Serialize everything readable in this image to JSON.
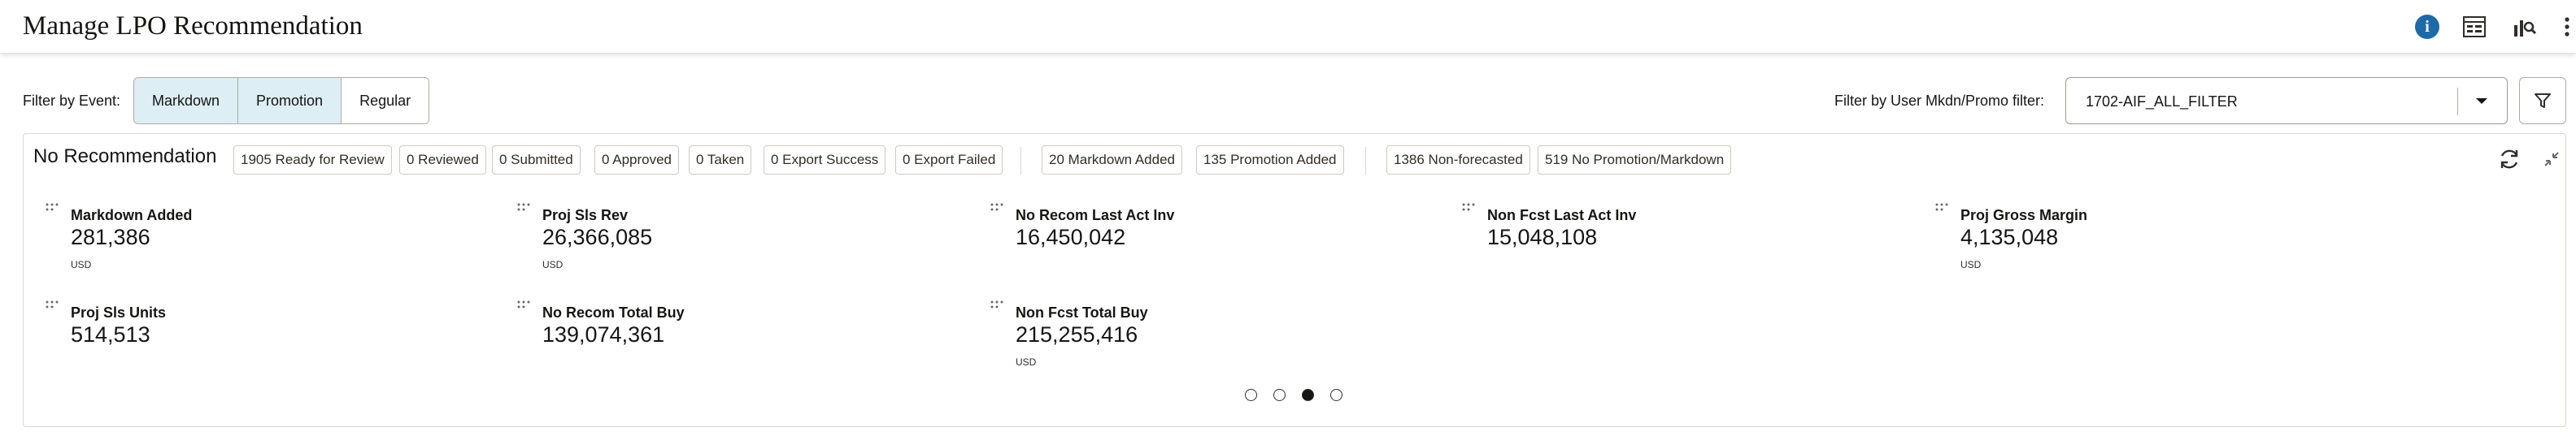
{
  "header": {
    "title": "Manage LPO Recommendation",
    "icons": [
      "info-icon",
      "table-view-icon",
      "chart-search-icon",
      "more-icon"
    ],
    "accent": "#1e6aa8"
  },
  "filters": {
    "event_label": "Filter by Event:",
    "events": [
      {
        "label": "Markdown",
        "active": true
      },
      {
        "label": "Promotion",
        "active": true
      },
      {
        "label": "Regular",
        "active": false
      }
    ],
    "user_filter_label": "Filter by User Mkdn/Promo filter:",
    "user_filter_value": "1702-AIF_ALL_FILTER"
  },
  "panel": {
    "title": "No Recommendation",
    "chips_group1": [
      "1905 Ready for Review",
      "0 Reviewed",
      "0 Submitted",
      "0 Approved",
      "0 Taken",
      "0 Export Success",
      "0 Export Failed"
    ],
    "chips_group2": [
      "20 Markdown Added",
      "135 Promotion Added"
    ],
    "chips_group3": [
      "1386 Non-forecasted",
      "519 No Promotion/Markdown"
    ],
    "metrics_row1": [
      {
        "label": "Markdown Added",
        "value": "281,386",
        "unit": "USD"
      },
      {
        "label": "Proj Sls Rev",
        "value": "26,366,085",
        "unit": "USD"
      },
      {
        "label": "No Recom Last Act Inv",
        "value": "16,450,042",
        "unit": ""
      },
      {
        "label": "Non Fcst Last Act Inv",
        "value": "15,048,108",
        "unit": ""
      },
      {
        "label": "Proj Gross Margin",
        "value": "4,135,048",
        "unit": "USD"
      }
    ],
    "metrics_row2": [
      {
        "label": "Proj Sls Units",
        "value": "514,513",
        "unit": ""
      },
      {
        "label": "No Recom Total Buy",
        "value": "139,074,361",
        "unit": ""
      },
      {
        "label": "Non Fcst Total Buy",
        "value": "215,255,416",
        "unit": "USD"
      }
    ],
    "pagination": {
      "pages": 4,
      "current": 3
    }
  }
}
